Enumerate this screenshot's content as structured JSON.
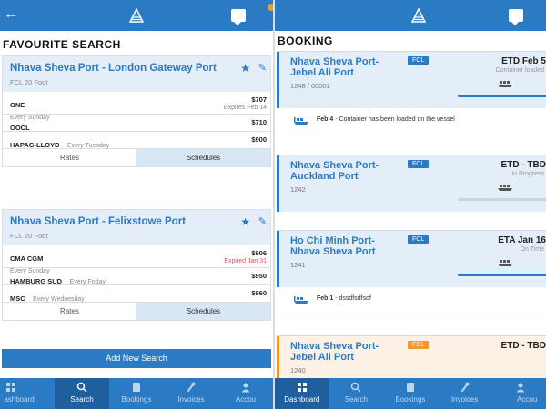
{
  "left": {
    "section_title": "FAVOURITE SEARCH",
    "back_icon": "back-arrow-icon",
    "favourites": [
      {
        "route": "Nhava Sheva Port - London Gateway Port",
        "container": "FCL 20 Foot",
        "carriers": [
          {
            "name": "ONE",
            "frequency": "Every Sunday",
            "price": "$707",
            "expiry": "Expires Feb 14",
            "expired": false
          },
          {
            "name": "OOCL",
            "frequency": "",
            "price": "$710",
            "expiry": "",
            "expired": false
          },
          {
            "name": "HAPAG-LLOYD",
            "frequency": "Every Tuesday",
            "price": "$900",
            "expiry": "",
            "expired": false
          }
        ],
        "tabs": [
          "Rates",
          "Schedules"
        ],
        "active_tab": 1
      },
      {
        "route": "Nhava Sheva Port - Felixstowe Port",
        "container": "FCL 20 Foot",
        "carriers": [
          {
            "name": "CMA CGM",
            "frequency": "Every Sunday",
            "price": "$906",
            "expiry": "Expired Jan 31",
            "expired": true
          },
          {
            "name": "HAMBURG SUD",
            "frequency": "Every Friday",
            "price": "$950",
            "expiry": "",
            "expired": false
          },
          {
            "name": "MSC",
            "frequency": "Every Wednesday",
            "price": "$960",
            "expiry": "",
            "expired": false
          }
        ],
        "tabs": [
          "Rates",
          "Schedules"
        ],
        "active_tab": 1
      }
    ],
    "add_button": "Add New Search",
    "nav": [
      "Dashboard",
      "Search",
      "Bookings",
      "Invoices",
      "Account"
    ],
    "nav_visible": [
      "ashboard",
      "Search",
      "Bookings",
      "Invoices",
      "Accou"
    ],
    "nav_active": 1
  },
  "right": {
    "section_title": "BOOKING",
    "bookings": [
      {
        "route": "Nhava Sheva Port-Jebel Ali Port",
        "badge": "FCL",
        "badge_color": "#2b7bc4",
        "eta": "ETD Feb 5",
        "status": "Container loaded",
        "ref": "1248 / 00001",
        "progress": 1.0,
        "event_date": "Feb 4",
        "event_text": " - Container has been loaded on the vessel"
      },
      {
        "route": "Nhava Sheva Port-Auckland Port",
        "badge": "FCL",
        "badge_color": "#2b7bc4",
        "eta": "ETD - TBD",
        "status": "In Progress",
        "ref": "1242",
        "progress": 0.0,
        "event_date": "",
        "event_text": ""
      },
      {
        "route": "Ho Chi Minh Port-Nhava Sheva Port",
        "badge": "FCL",
        "badge_color": "#2b7bc4",
        "eta": "ETA Jan 16",
        "status": "On Time",
        "ref": "1241",
        "progress": 1.0,
        "event_date": "Feb 1",
        "event_text": " - dssdfsdfsdf"
      },
      {
        "route": "Nhava Sheva Port-Jebel Ali Port",
        "badge": "FCL",
        "badge_color": "#f09a2a",
        "eta": "ETD - TBD",
        "status": "",
        "ref": "1240",
        "progress": 0.0,
        "event_date": "",
        "event_text": ""
      }
    ],
    "nav_visible": [
      "Dashboard",
      "Search",
      "Bookings",
      "Invoices",
      "Accou"
    ],
    "nav_active": 0
  },
  "colors": {
    "brand_blue": "#2b7bc4",
    "nav_active": "#1f5f9e",
    "accent_orange": "#f09a2a",
    "expired_red": "#e05050",
    "card_head": "#e4eef8"
  },
  "icons": {
    "logo": "company-logo-icon",
    "chat": "chat-icon",
    "star": "star-icon",
    "edit": "edit-pencil-icon",
    "ship": "container-ship-icon",
    "nav": [
      "dashboard-grid-icon",
      "search-icon",
      "bookings-icon",
      "invoices-icon",
      "account-icon"
    ]
  }
}
